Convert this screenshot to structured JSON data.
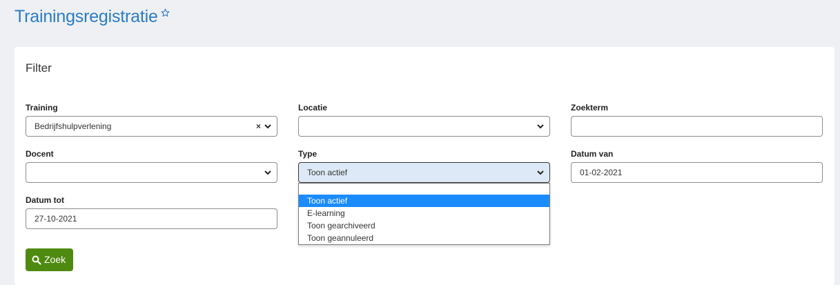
{
  "header": {
    "title": "Trainingsregistratie",
    "favorite_icon": "star-outline-icon"
  },
  "filter": {
    "title": "Filter",
    "fields": {
      "training": {
        "label": "Training",
        "value": "Bedrijfshulpverlening",
        "clear_symbol": "×"
      },
      "locatie": {
        "label": "Locatie",
        "value": ""
      },
      "zoekterm": {
        "label": "Zoekterm",
        "value": ""
      },
      "docent": {
        "label": "Docent",
        "value": ""
      },
      "type": {
        "label": "Type",
        "value": "Toon actief",
        "options": [
          "Toon actief",
          "E-learning",
          "Toon gearchiveerd",
          "Toon geannuleerd"
        ],
        "selected_index": 0
      },
      "datum_van": {
        "label": "Datum van",
        "value": "01-02-2021"
      },
      "datum_tot": {
        "label": "Datum tot",
        "value": "27-10-2021"
      }
    },
    "search_button": {
      "label": "Zoek",
      "icon": "search-icon",
      "color": "#4f8a10"
    }
  },
  "colors": {
    "accent": "#2b7cc4",
    "selected_option": "#1a8cff",
    "focused_field": "#dde9f6"
  }
}
